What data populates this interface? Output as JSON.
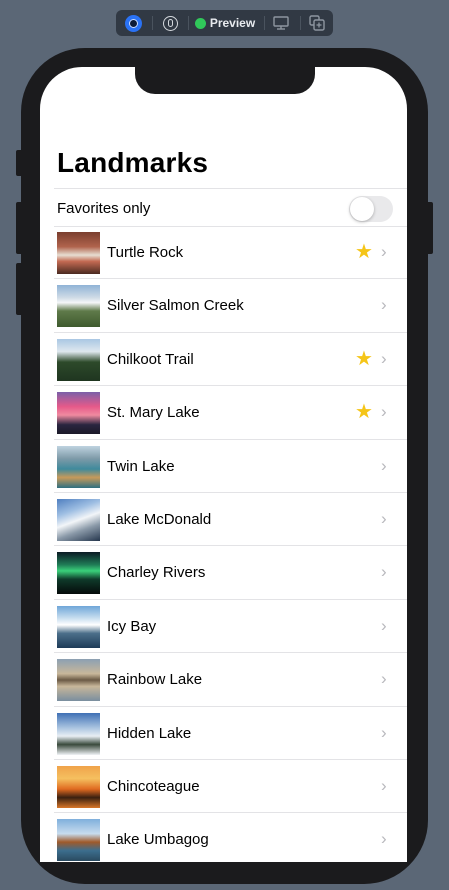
{
  "toolbar": {
    "live_icon": "live-preview-icon",
    "inspect_icon": "inspect-icon",
    "preview_label": "Preview",
    "device_icon": "device-settings-icon",
    "duplicate_icon": "duplicate-icon"
  },
  "screen": {
    "title": "Landmarks",
    "favorites_label": "Favorites only",
    "favorites_toggle_on": false
  },
  "landmarks": [
    {
      "name": "Turtle Rock",
      "favorite": true
    },
    {
      "name": "Silver Salmon Creek",
      "favorite": false
    },
    {
      "name": "Chilkoot Trail",
      "favorite": true
    },
    {
      "name": "St. Mary Lake",
      "favorite": true
    },
    {
      "name": "Twin Lake",
      "favorite": false
    },
    {
      "name": "Lake McDonald",
      "favorite": false
    },
    {
      "name": "Charley Rivers",
      "favorite": false
    },
    {
      "name": "Icy Bay",
      "favorite": false
    },
    {
      "name": "Rainbow Lake",
      "favorite": false
    },
    {
      "name": "Hidden Lake",
      "favorite": false
    },
    {
      "name": "Chincoteague",
      "favorite": false
    },
    {
      "name": "Lake Umbagog",
      "favorite": false
    }
  ],
  "colors": {
    "star": "#f5c518",
    "accent": "#2a72f5",
    "preview_dot": "#30c85a"
  }
}
